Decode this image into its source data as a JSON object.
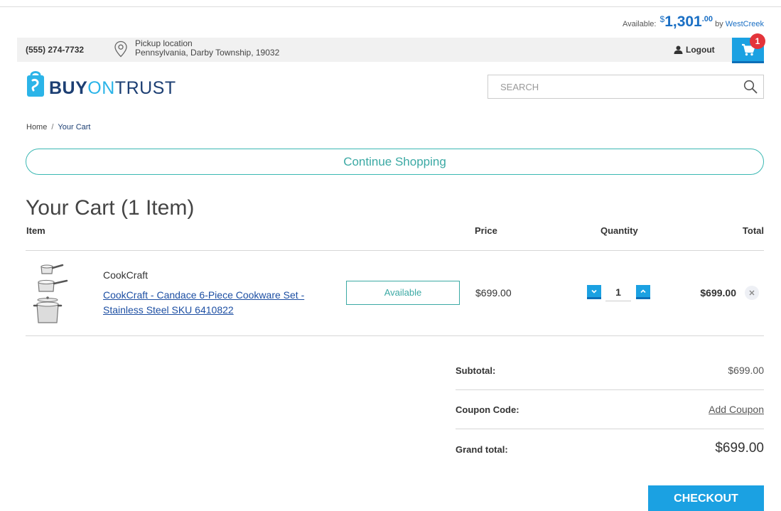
{
  "header": {
    "available_label": "Available:",
    "available_currency": "$",
    "available_amount": "1,301",
    "available_cents": ".00",
    "by_label": "by",
    "lender": "WestCreek",
    "phone": "(555) 274-7732",
    "pickup_title": "Pickup location",
    "pickup_address": "Pennsylvania, Darby Township, 19032",
    "logout_label": "Logout",
    "cart_count": "1"
  },
  "brand": {
    "logo_part1": "BUY",
    "logo_part2": "ON",
    "logo_part3": "TRUST"
  },
  "search": {
    "placeholder": "SEARCH"
  },
  "breadcrumb": {
    "home": "Home",
    "separator": "/",
    "current": "Your Cart"
  },
  "continue_label": "Continue Shopping",
  "cart": {
    "title": "Your Cart (1 Item)",
    "columns": {
      "item": "Item",
      "price": "Price",
      "quantity": "Quantity",
      "total": "Total"
    },
    "items": [
      {
        "brand": "CookCraft",
        "name": "CookCraft - Candace 6-Piece Cookware Set - Stainless Steel SKU 6410822",
        "availability": "Available",
        "price": "$699.00",
        "quantity": "1",
        "total": "$699.00"
      }
    ]
  },
  "summary": {
    "subtotal_label": "Subtotal:",
    "subtotal_value": "$699.00",
    "coupon_label": "Coupon Code:",
    "coupon_action": "Add Coupon",
    "grand_label": "Grand total:",
    "grand_value": "$699.00"
  },
  "checkout_label": "CHECKOUT",
  "colors": {
    "accent_blue": "#1ba1e2",
    "brand_navy": "#1d3f73",
    "teal": "#3ba9a4",
    "badge_red": "#e4343a"
  }
}
